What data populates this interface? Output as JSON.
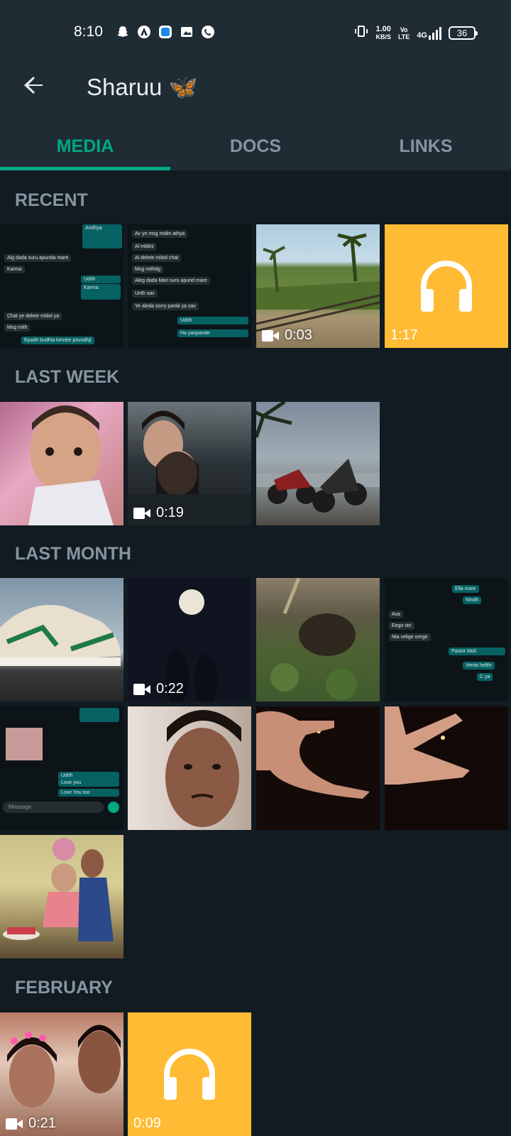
{
  "status": {
    "time": "8:10",
    "net_speed_value": "1.00",
    "net_speed_unit": "KB/S",
    "volte": "Vo\nLTE",
    "network": "4G",
    "battery": "36"
  },
  "header": {
    "title": "Sharuu 🦋"
  },
  "tabs": [
    {
      "label": "MEDIA",
      "active": true
    },
    {
      "label": "DOCS",
      "active": false
    },
    {
      "label": "LINKS",
      "active": false
    }
  ],
  "sections": [
    {
      "title": "RECENT"
    },
    {
      "title": "LAST WEEK"
    },
    {
      "title": "LAST MONTH"
    },
    {
      "title": "FEBRUARY"
    }
  ],
  "media": {
    "recent": [
      {
        "kind": "image"
      },
      {
        "kind": "image"
      },
      {
        "kind": "video",
        "duration": "0:03"
      },
      {
        "kind": "audio",
        "duration": "1:17"
      }
    ],
    "last_week": [
      {
        "kind": "image"
      },
      {
        "kind": "video",
        "duration": "0:19"
      },
      {
        "kind": "image"
      }
    ],
    "last_month": [
      {
        "kind": "image"
      },
      {
        "kind": "video",
        "duration": "0:22"
      },
      {
        "kind": "image"
      },
      {
        "kind": "image"
      },
      {
        "kind": "image"
      },
      {
        "kind": "image"
      },
      {
        "kind": "image"
      },
      {
        "kind": "image"
      },
      {
        "kind": "image"
      }
    ],
    "february": [
      {
        "kind": "video",
        "duration": "0:21"
      },
      {
        "kind": "audio",
        "duration": "0:09"
      }
    ]
  },
  "chat_snippets": {
    "tile1": [
      "Andhya",
      "Alg dada suru apunda mare",
      "Karma",
      "Udith",
      "Karma",
      "Chat ye delete mldol ya",
      "Msg mith",
      "Epadh budhla kendre povodhji"
    ],
    "tile2": [
      "Av yn msg midin athya",
      "Al mldini",
      "Al delete mldol chat",
      "Msg mithdg",
      "Aleg dada Mari suru apund mare",
      "Unth sav",
      "Ye aleda sorry panla ya sav",
      "Udith",
      "Ha yanpande"
    ],
    "tile4m": [
      "Ella mare",
      "Nindh",
      "Ava",
      "Eego stri",
      "Nia velige orege",
      "Pastor Moli",
      "Venta helthi",
      "C ya"
    ],
    "tile5m": [
      "Udith",
      "Love you",
      "Love You too",
      "Message"
    ]
  },
  "colors": {
    "accent": "#00a884",
    "appbar": "#1f2c34",
    "background": "#121b22",
    "audio_tile": "#ffbb33"
  }
}
